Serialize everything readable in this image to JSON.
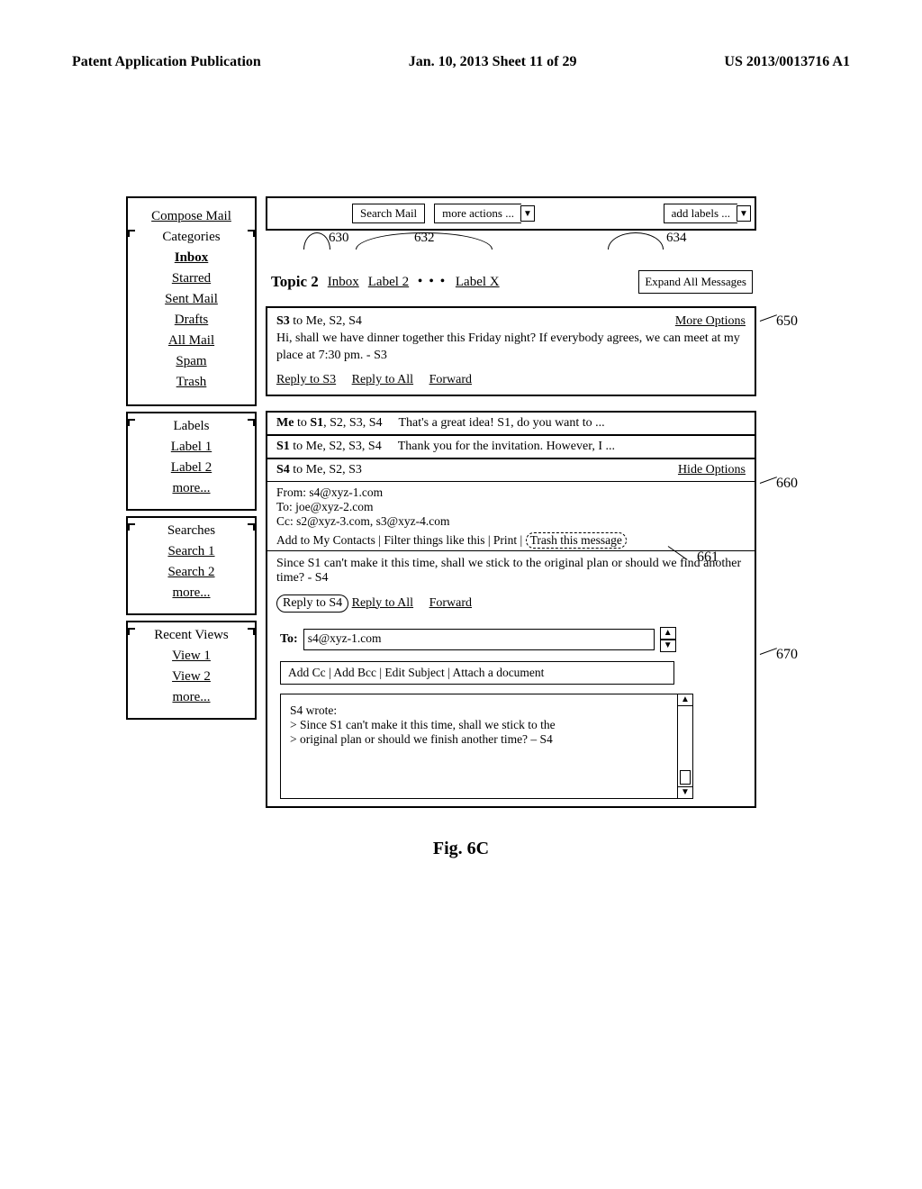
{
  "doc_header": {
    "left": "Patent Application Publication",
    "center": "Jan. 10, 2013  Sheet 11 of 29",
    "right": "US 2013/0013716 A1"
  },
  "sidebar": {
    "compose": "Compose Mail",
    "categories_title": "Categories",
    "categories": [
      "Inbox",
      "Starred",
      "Sent Mail",
      "Drafts",
      "All Mail",
      "Spam",
      "Trash"
    ],
    "labels_title": "Labels",
    "labels": [
      "Label 1",
      "Label 2",
      "more..."
    ],
    "searches_title": "Searches",
    "searches": [
      "Search 1",
      "Search 2",
      "more..."
    ],
    "recent_title": "Recent Views",
    "recent": [
      "View 1",
      "View 2",
      "more..."
    ]
  },
  "toolbar": {
    "search": "Search Mail",
    "more_actions": "more actions ...",
    "add_labels": "add labels ..."
  },
  "callout": {
    "c630": "630",
    "c632": "632",
    "c634": "634"
  },
  "topic": {
    "title": "Topic 2",
    "inbox": "Inbox",
    "label2": "Label 2",
    "dots": "• • •",
    "labelx": "Label X",
    "expand": "Expand All Messages"
  },
  "msg1": {
    "who_html": "S3 to Me, S2, S4",
    "options": "More Options",
    "body": "Hi, shall we have dinner together this Friday night? If everybody agrees, we can meet at my place at 7:30 pm. - S3",
    "reply": "Reply to S3",
    "reply_all": "Reply to All",
    "forward": "Forward"
  },
  "collapsed1": {
    "who": "Me to S1, S2, S3, S4",
    "who_bold_prefix": "Me",
    "who_bold_mid": "S1",
    "snippet": "That's a great idea! S1, do you want to ..."
  },
  "collapsed2": {
    "who_bold": "S1",
    "who_rest": " to Me, S2, S3, S4",
    "snippet": "Thank you for the invitation. However, I ..."
  },
  "expanded": {
    "who_bold": "S4",
    "who_rest": " to Me, S2, S3",
    "hide": "Hide Options",
    "from": "From: s4@xyz-1.com",
    "to": "To: joe@xyz-2.com",
    "cc": "Cc: s2@xyz-3.com, s3@xyz-4.com",
    "meta_actions_pre": "Add to My Contacts | Filter things like this | Print |",
    "trash": "Trash this message",
    "body": "Since S1 can't make it this time, shall we stick to the original plan or should we find another time? - S4",
    "reply": "Reply to S4",
    "reply_all": "Reply to All",
    "forward": "Forward"
  },
  "compose": {
    "to_label": "To:",
    "to_value": "s4@xyz-1.com",
    "opts": "Add Cc | Add Bcc | Edit Subject | Attach a document",
    "body_intro": "S4 wrote:",
    "body_l1": "> Since S1 can't make it this time, shall we stick to the",
    "body_l2": "> original plan or should we finish another time? – S4"
  },
  "refs": {
    "r650": "650",
    "r660": "660",
    "r661": "661",
    "r670": "670"
  },
  "figure_caption": "Fig. 6C"
}
